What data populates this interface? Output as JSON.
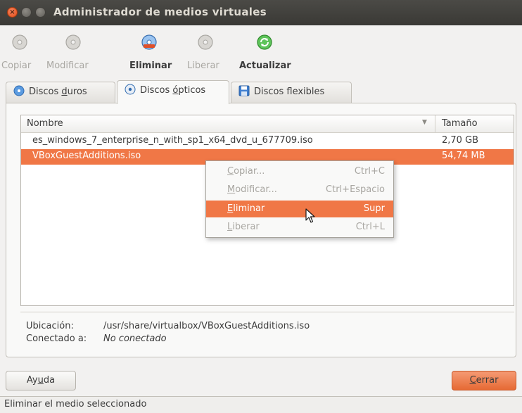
{
  "window": {
    "title": "Administrador de medios virtuales"
  },
  "toolbar": {
    "items": [
      {
        "label": "Copiar",
        "icon": "copy-disk-icon",
        "enabled": false
      },
      {
        "label": "Modificar",
        "icon": "modify-disk-icon",
        "enabled": false
      },
      {
        "label": "Eliminar",
        "icon": "remove-disk-icon",
        "enabled": true
      },
      {
        "label": "Liberar",
        "icon": "release-disk-icon",
        "enabled": false
      },
      {
        "label": "Actualizar",
        "icon": "refresh-icon",
        "enabled": true
      }
    ]
  },
  "tabs": [
    {
      "label_pre": "Discos ",
      "label_u": "d",
      "label_post": "uros",
      "icon": "hard-disk-icon",
      "active": false
    },
    {
      "label_pre": "Discos ",
      "label_u": "ó",
      "label_post": "pticos",
      "icon": "optical-disk-icon",
      "active": true
    },
    {
      "label_pre": "Discos ",
      "label_u": "",
      "label_post": "flexibles",
      "icon": "floppy-disk-icon",
      "active": false
    }
  ],
  "list": {
    "columns": {
      "name": "Nombre",
      "size": "Tamaño"
    },
    "rows": [
      {
        "name": "es_windows_7_enterprise_n_with_sp1_x64_dvd_u_677709.iso",
        "size": "2,70 GB",
        "selected": false
      },
      {
        "name": "VBoxGuestAdditions.iso",
        "size": "54,74 MB",
        "selected": true
      }
    ]
  },
  "context_menu": {
    "items": [
      {
        "label_u": "C",
        "label_rest": "opiar...",
        "shortcut": "Ctrl+C",
        "state": "disabled"
      },
      {
        "label_u": "M",
        "label_rest": "odificar...",
        "shortcut": "Ctrl+Espacio",
        "state": "disabled"
      },
      {
        "label_u": "E",
        "label_rest": "liminar",
        "shortcut": "Supr",
        "state": "hover"
      },
      {
        "label_u": "L",
        "label_rest": "iberar",
        "shortcut": "Ctrl+L",
        "state": "disabled"
      }
    ]
  },
  "info": {
    "location_label": "Ubicación:",
    "location_value": "/usr/share/virtualbox/VBoxGuestAdditions.iso",
    "attached_label": "Conectado a:",
    "attached_value": "No conectado"
  },
  "buttons": {
    "help_pre": "Ay",
    "help_u": "u",
    "help_post": "da",
    "close_u": "C",
    "close_post": "errar"
  },
  "status": {
    "text": "Eliminar el medio seleccionado"
  },
  "colors": {
    "accent": "#f07746",
    "titlebar": "#3c3b37"
  }
}
